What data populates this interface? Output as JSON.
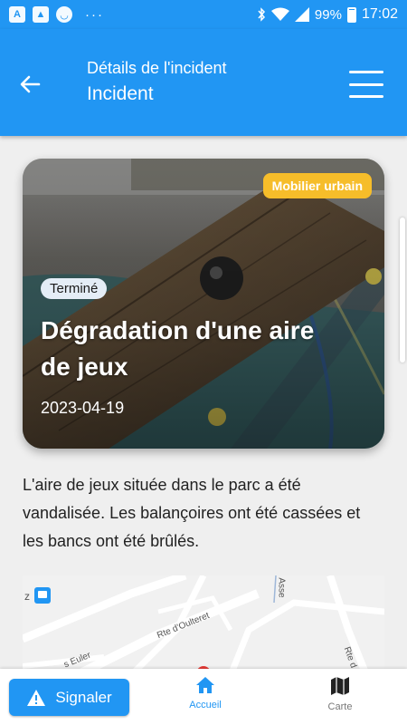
{
  "status_bar": {
    "battery": "99%",
    "time": "17:02",
    "dots": "···"
  },
  "app_bar": {
    "subtitle": "Détails de l'incident",
    "title": "Incident"
  },
  "incident": {
    "category": "Mobilier urbain",
    "status": "Terminé",
    "title": "Dégradation d'une aire de jeux",
    "date": "2023-04-19",
    "description": "L'aire de jeux située dans le parc a été vandalisée. Les balançoires ont été cassées et les bancs ont été brûlés."
  },
  "map": {
    "labels": [
      "Rte d'Oulteret",
      "s Euler",
      "Asse",
      "Rte d",
      "z"
    ]
  },
  "bottom_bar": {
    "report_label": "Signaler",
    "nav_home_label": "Accueil",
    "nav_map_label": "Carte"
  },
  "colors": {
    "primary": "#2196f3",
    "category_badge": "#f6bd2a",
    "status_chip": "#e4edf6"
  },
  "icons": {
    "back": "arrow-left-icon",
    "menu": "hamburger-menu-icon",
    "report": "warning-icon",
    "home": "home-icon",
    "map": "map-icon"
  }
}
